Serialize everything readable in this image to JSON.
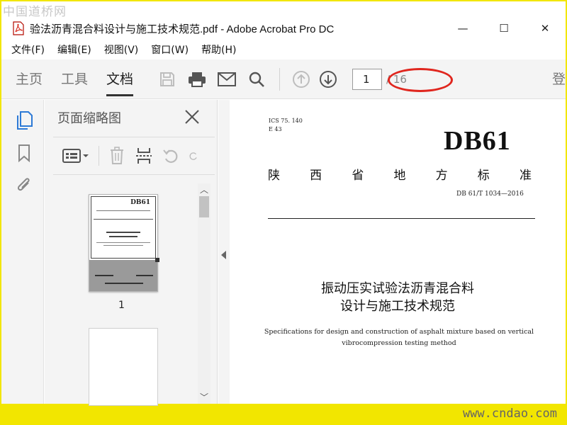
{
  "watermarks": {
    "top": "中国道桥网",
    "bottom": "www.cndao.com"
  },
  "window": {
    "title": "验法沥青混合料设计与施工技术规范.pdf - Adobe Acrobat Pro DC",
    "controls": [
      "—",
      "☐",
      "✕"
    ]
  },
  "menu": [
    "文件(F)",
    "编辑(E)",
    "视图(V)",
    "窗口(W)",
    "帮助(H)"
  ],
  "toolbar": {
    "tabs": [
      {
        "label": "主页",
        "active": false
      },
      {
        "label": "工具",
        "active": false
      },
      {
        "label": "文档",
        "active": true
      }
    ],
    "icons": [
      "save-icon",
      "print-icon",
      "email-icon",
      "search-icon",
      "previous-page-icon",
      "next-page-icon"
    ],
    "current_page": "1",
    "total_pages": "/ 16",
    "login_label": "登"
  },
  "left_rail": {
    "icons": [
      "page-thumbnails-icon",
      "bookmarks-icon",
      "attachments-icon"
    ]
  },
  "thumbnail_panel": {
    "title": "页面缩略图",
    "tools": [
      "options-menu-icon",
      "delete-icon",
      "extract-icon",
      "rotate-left-icon",
      "rotate-right-icon"
    ],
    "thumbnails": [
      {
        "page_label": "1",
        "selected": true
      },
      {
        "page_label": "",
        "selected": false
      }
    ]
  },
  "document": {
    "ics": "ICS 75. 140",
    "class_code": "E 43",
    "code": "DB61",
    "standard_name_chars": [
      "陕",
      "西",
      "省",
      "地",
      "方",
      "标",
      "准"
    ],
    "standard_number": "DB 61/T 1034—2016",
    "title_line1": "振动压实试验法沥青混合料",
    "title_line2": "设计与施工技术规范",
    "english_line1": "Specifications for design and construction of asphalt mixture based on vertical",
    "english_line2": "vibrocompression testing method"
  },
  "colors": {
    "frame": "#f2e600",
    "highlight": "#e0261e",
    "toolbar_bg": "#f4f4f4"
  }
}
